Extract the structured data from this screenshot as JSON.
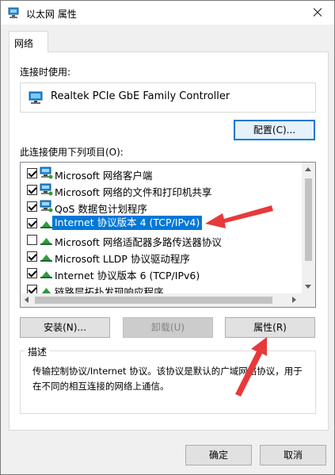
{
  "window": {
    "title": "以太网 属性",
    "close_icon": "close-icon"
  },
  "tab": {
    "label": "网络"
  },
  "connect_using": {
    "label": "连接时使用:",
    "adapter_name": "Realtek PCIe GbE Family Controller",
    "configure_button": "配置(C)..."
  },
  "items": {
    "label": "此连接使用下列项目(O):",
    "list": [
      {
        "label": "Microsoft 网络客户端",
        "checked": true,
        "icon": "network-client-icon"
      },
      {
        "label": "Microsoft 网络的文件和打印机共享",
        "checked": true,
        "icon": "network-client-icon"
      },
      {
        "label": "QoS 数据包计划程序",
        "checked": true,
        "icon": "network-client-icon"
      },
      {
        "label": "Internet 协议版本 4 (TCP/IPv4)",
        "checked": true,
        "icon": "protocol-icon",
        "selected": true
      },
      {
        "label": "Microsoft 网络适配器多路传送器协议",
        "checked": false,
        "icon": "protocol-icon"
      },
      {
        "label": "Microsoft LLDP 协议驱动程序",
        "checked": true,
        "icon": "protocol-icon"
      },
      {
        "label": "Internet 协议版本 6 (TCP/IPv6)",
        "checked": true,
        "icon": "protocol-icon"
      },
      {
        "label": "链路层拓扑发现响应程序",
        "checked": true,
        "icon": "protocol-icon"
      }
    ]
  },
  "buttons": {
    "install": "安装(N)...",
    "uninstall": "卸载(U)",
    "properties": "属性(R)"
  },
  "description": {
    "title": "描述",
    "text": "传输控制协议/Internet 协议。该协议是默认的广域网络协议，用于在不同的相互连接的网络上通信。"
  },
  "footer": {
    "ok": "确定",
    "cancel": "取消"
  },
  "colors": {
    "selection": "#0078d7",
    "annotation_arrow": "#e8393a",
    "window_bg": "#f0f0f0"
  }
}
